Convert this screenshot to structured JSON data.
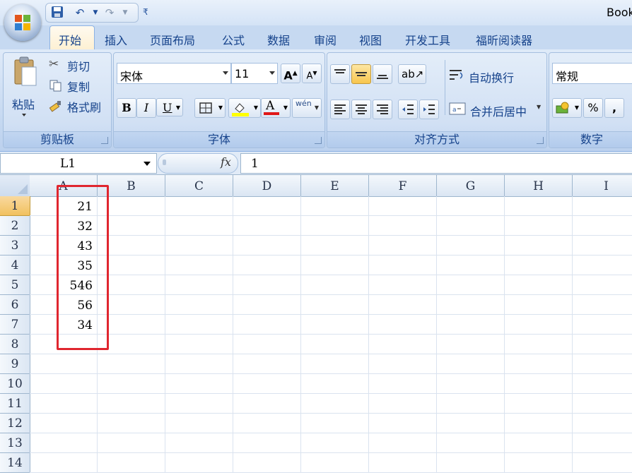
{
  "window": {
    "title": "Book"
  },
  "tabs": [
    "开始",
    "插入",
    "页面布局",
    "公式",
    "数据",
    "审阅",
    "视图",
    "开发工具",
    "福昕阅读器"
  ],
  "active_tab": "开始",
  "ribbon": {
    "clipboard": {
      "label": "剪贴板",
      "paste": "粘贴",
      "cut": "剪切",
      "copy": "复制",
      "format_painter": "格式刷"
    },
    "font": {
      "label": "字体",
      "name": "宋体",
      "size": "11",
      "bold": "B",
      "italic": "I",
      "underline": "U",
      "font_color_glyph": "A",
      "grow": "A",
      "shrink": "A",
      "phonetic": "wén"
    },
    "alignment": {
      "label": "对齐方式",
      "wrap_text": "自动换行",
      "merge_center": "合并后居中"
    },
    "number": {
      "label": "数字",
      "format": "常规",
      "percent": "%",
      "comma": ","
    }
  },
  "formula_bar": {
    "name_box": "L1",
    "fx": "fx",
    "value": "1"
  },
  "grid": {
    "columns": [
      "A",
      "B",
      "C",
      "D",
      "E",
      "F",
      "G",
      "H",
      "I"
    ],
    "rows": [
      "1",
      "2",
      "3",
      "4",
      "5",
      "6",
      "7",
      "8",
      "9",
      "10",
      "11",
      "12",
      "13",
      "14"
    ],
    "column_a_values": [
      "21",
      "32",
      "43",
      "35",
      "546",
      "56",
      "34"
    ]
  },
  "colors": {
    "highlight": "#e0262f",
    "ribbon": "#c6d9f1",
    "accent": "#15428b"
  }
}
